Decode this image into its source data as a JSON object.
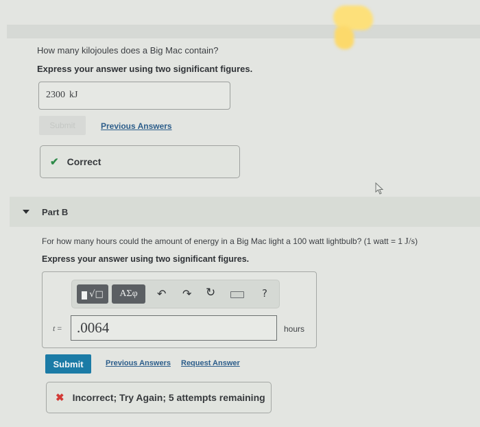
{
  "part_a": {
    "question": "How many kilojoules does a Big Mac contain?",
    "instruction": "Express your answer using two significant figures.",
    "answer_value": "2300",
    "answer_unit": "kJ",
    "submit_label": "Submit",
    "submit_enabled": false,
    "previous_answers_label": "Previous Answers",
    "feedback": {
      "status": "correct",
      "icon": "check-icon",
      "text": "Correct",
      "color": "#2e8b4a"
    }
  },
  "part_b": {
    "title": "Part B",
    "expanded": true,
    "question_text": "For how many hours could the amount of energy in a Big Mac light a 100 watt lightbulb? (1 watt = 1 ",
    "question_math": "J/s",
    "question_end": ")",
    "instruction": "Express your answer using two significant figures.",
    "toolbar": {
      "templates_label": "√□",
      "greek_label": "ΑΣφ",
      "undo_icon": "↶",
      "redo_icon": "↷",
      "reset_icon": "↻",
      "keyboard_icon": "keyboard-icon",
      "help_label": "?"
    },
    "variable": "t",
    "equals": " =",
    "answer_value": ".0064",
    "answer_unit": "hours",
    "submit_label": "Submit",
    "submit_color": "#1b7ba6",
    "previous_answers_label": "Previous Answers",
    "request_answer_label": "Request Answer",
    "feedback": {
      "status": "incorrect",
      "icon": "x-icon",
      "text": "Incorrect; Try Again; 5 attempts remaining",
      "color": "#d23a36"
    }
  }
}
